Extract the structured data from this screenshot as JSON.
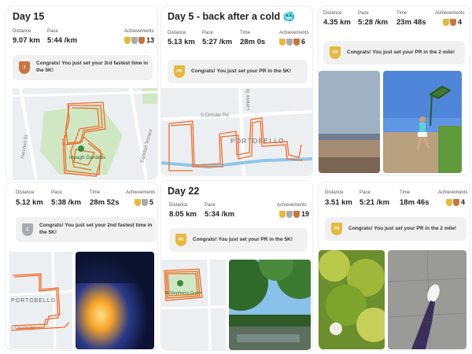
{
  "labels": {
    "distance": "Distance",
    "pace": "Pace",
    "time": "Time",
    "achievements": "Achievements"
  },
  "cards": [
    {
      "title": "Day 15",
      "distance": "9.07 km",
      "pace": "5:44 /km",
      "achievement_count": "13",
      "banner": "Congrats! You just set your 3rd fastest time in the 5K!",
      "banner_badge": "3",
      "map_label": "Iveagh Gardens"
    },
    {
      "title": "Day 5 - back after a cold 🥶",
      "distance": "5.13 km",
      "pace": "5:27 /km",
      "time": "28m 0s",
      "achievement_count": "6",
      "banner": "Congrats! You just set your PR in the 5K!",
      "banner_badge": "PR",
      "map_label": "PORTOBELLO",
      "street_labels": [
        "S Circular Rd",
        "Lennox St"
      ]
    },
    {
      "distance": "4.35 km",
      "pace": "5:28 /km",
      "time": "23m 48s",
      "achievement_count": "4",
      "banner": "Congrats! You just set your PR in the 2 mile!",
      "banner_badge": "PR"
    },
    {
      "distance": "5.12 km",
      "pace": "5:38 /km",
      "time": "28m 52s",
      "achievement_count": "5",
      "banner": "Congrats! You just set your 2nd fastest time in the 5K!",
      "banner_badge": "2",
      "map_label": "PORTOBELLO",
      "street_label": "S Circular Rd"
    },
    {
      "title": "Day 22",
      "distance": "8.05 km",
      "pace": "5:34 /km",
      "achievement_count": "19",
      "banner": "Congrats! You just set your PR in the 5K!",
      "banner_badge": "PR",
      "map_label": "St Stephen's Green"
    },
    {
      "distance": "3.51 km",
      "pace": "5:21 /km",
      "time": "18m 46s",
      "achievement_count": "4",
      "banner": "Congrats! You just set your PR in the 2 mile!",
      "banner_badge": "PR"
    }
  ],
  "map_street_labels": [
    "Harcourt St",
    "Earlsfort Terrace"
  ],
  "colors": {
    "route": "#f26b2a",
    "park": "#cfe8c3",
    "gold": "#e7b93b",
    "silver": "#a9abb0",
    "bronze": "#c9753f",
    "banner_bg": "#f1f1f1"
  },
  "icons": [
    "medal-icon",
    "map-pin-icon",
    "trophy-icon"
  ]
}
